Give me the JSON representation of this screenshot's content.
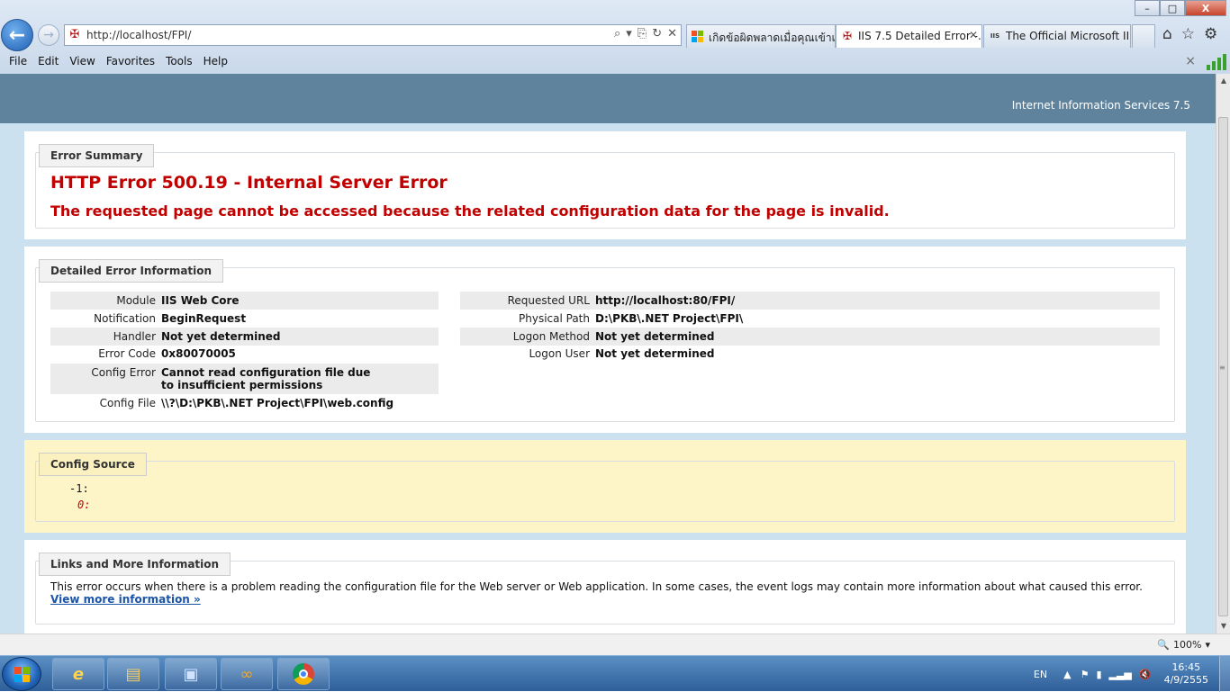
{
  "browser": {
    "ghost_tabs": [
      "",
      "",
      "",
      "",
      "",
      "",
      "",
      ""
    ],
    "address": {
      "url": "http://localhost/FPI/"
    },
    "tabs": [
      {
        "label": "เกิดข้อผิดพลาดเมื่อคุณเข้าเ...",
        "icon": "windows-icon"
      },
      {
        "label": "IIS 7.5 Detailed Error -...",
        "icon": "iis-icon",
        "active": true
      },
      {
        "label": "The Official Microsoft II...",
        "icon": "iis-logo-icon"
      }
    ],
    "tab_iis_badge": "IIS",
    "menu": [
      "File",
      "Edit",
      "View",
      "Favorites",
      "Tools",
      "Help"
    ],
    "menu_close": "×",
    "window_buttons": {
      "minimize": "–",
      "maximize": "□",
      "close": "X"
    },
    "zoom": "100%"
  },
  "page": {
    "product": "Internet Information Services 7.5",
    "error_summary": {
      "legend": "Error Summary",
      "title": "HTTP Error 500.19 - Internal Server Error",
      "message": "The requested page cannot be accessed because the related configuration data for the page is invalid."
    },
    "detailed": {
      "legend": "Detailed Error Information",
      "left": [
        {
          "key": "Module",
          "value": "IIS Web Core"
        },
        {
          "key": "Notification",
          "value": "BeginRequest"
        },
        {
          "key": "Handler",
          "value": "Not yet determined"
        },
        {
          "key": "Error Code",
          "value": "0x80070005"
        },
        {
          "key": "Config Error",
          "value": "Cannot read configuration file due to insufficient permissions"
        },
        {
          "key": "Config File",
          "value": "\\\\?\\D:\\PKB\\.NET Project\\FPI\\web.config"
        }
      ],
      "right": [
        {
          "key": "Requested URL",
          "value": "http://localhost:80/FPI/"
        },
        {
          "key": "Physical Path",
          "value": "D:\\PKB\\.NET Project\\FPI\\"
        },
        {
          "key": "Logon Method",
          "value": "Not yet determined"
        },
        {
          "key": "Logon User",
          "value": "Not yet determined"
        }
      ]
    },
    "config_source": {
      "legend": "Config Source",
      "lines": [
        {
          "num": "-1:",
          "text": ""
        },
        {
          "num": "0:",
          "text": ""
        }
      ]
    },
    "links": {
      "legend": "Links and More Information",
      "text": "This error occurs when there is a problem reading the configuration file for the Web server or Web application. In some cases, the event logs may contain more information about what caused this error.",
      "more_link": "View more information »"
    }
  },
  "taskbar": {
    "language": "EN",
    "time": "16:45",
    "date": "4/9/2555"
  },
  "colors": {
    "header": "#5f839d",
    "error_red": "#c10000",
    "link_blue": "#1a55a8",
    "source_bg": "#fdf4c8"
  }
}
